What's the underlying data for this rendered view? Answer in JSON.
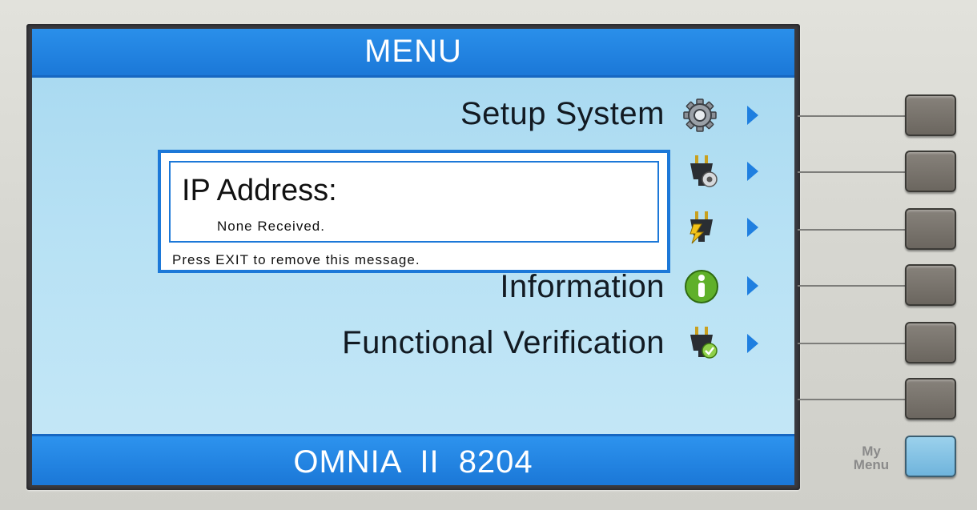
{
  "header": {
    "title": "MENU"
  },
  "menu": {
    "items": [
      {
        "label": "Setup System",
        "icon": "gear-icon"
      },
      {
        "label": "",
        "icon": "plug-gear-icon"
      },
      {
        "label": "",
        "icon": "plug-lightning-icon"
      },
      {
        "label": "Information",
        "icon": "info-icon"
      },
      {
        "label": "Functional Verification",
        "icon": "plug-check-icon"
      }
    ]
  },
  "dialog": {
    "title": "IP Address:",
    "value": "None Received.",
    "footer": "Press EXIT to remove this message."
  },
  "footer": {
    "model": "OMNIA II   8204"
  },
  "hardware": {
    "my_menu_label": "My\nMenu"
  },
  "colors": {
    "accent": "#1f7fe0",
    "screen_bg": "#b7e1f4",
    "soft_key": "#77726b"
  }
}
